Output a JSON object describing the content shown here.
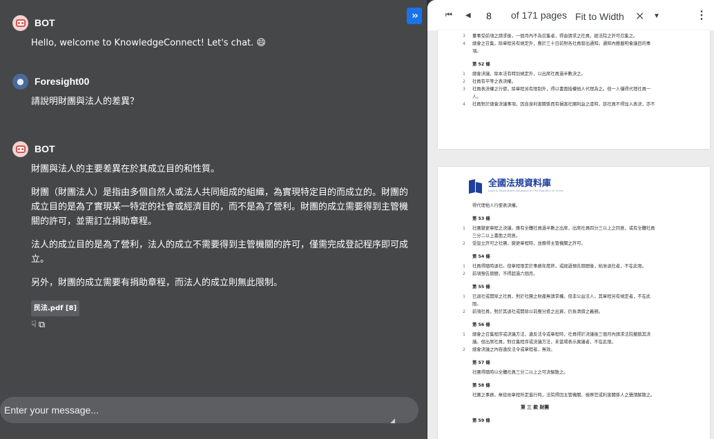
{
  "chat": {
    "expand_icon": "chevrons-right-icon",
    "messages": [
      {
        "sender": "BOT",
        "paragraphs": [
          "Hello, welcome to KnowledgeConnect! Let's chat. 😄"
        ]
      },
      {
        "sender": "Foresight00",
        "paragraphs": [
          "請說明財團與法人的差異？"
        ]
      },
      {
        "sender": "BOT",
        "paragraphs": [
          "財團與法人的主要差異在於其成立目的和性質。",
          "財團（財團法人）是指由多個自然人或法人共同組成的組織，為實現特定目的而成立的。財團的成立目的是為了實現某一特定的社會或經濟目的，而不是為了營利。財團的成立需要得到主管機關的許可，並需訂立捐助章程。",
          "法人的成立目的是為了營利，法人的成立不需要得到主管機關的許可，僅需完成登記程序即可成立。",
          "另外，財團的成立需要有捐助章程，而法人的成立則無此限制。"
        ],
        "source_chip": "民法.pdf [8]"
      }
    ],
    "input_placeholder": "Enter your message..."
  },
  "viewer": {
    "page_number": "8",
    "page_total_label": "of 171 pages",
    "zoom_label": "Fit to Width",
    "clear_symbol": "✕",
    "dropdown_symbol": "▼",
    "more_symbol": "⋮",
    "first_symbol": "⏮",
    "prev_symbol": "◀"
  },
  "pdf": {
    "page1_lines": [
      {
        "n": "3",
        "t": "董事受前項之請求後，一個月內不為召集者，得由請求之社員，經法院之許可召集之。"
      },
      {
        "n": "4",
        "t": "總會之召集，除章程另有規定外，應於三十日前對各社員發出通知。通知內應載明會議目的事"
      },
      {
        "n": "",
        "t": "項。"
      }
    ],
    "page1_art52": "第 52 條",
    "page1_art52_lines": [
      {
        "n": "1",
        "t": "總會決議，除本法有特別規定外，以出席社員過半數決之。"
      },
      {
        "n": "2",
        "t": "社員有平等之表決權。"
      },
      {
        "n": "3",
        "t": "社員表決權之行使，除章程另有限制外，得以書面授權他人代理為之。但一人僅得代理社員一"
      },
      {
        "n": "",
        "t": "人。"
      },
      {
        "n": "4",
        "t": "社員對於總會決議事項，因自身利害關係而有損害社團利益之虞時，該社員不得加入表決，亦不"
      }
    ],
    "logo_text": "全國法規資料庫",
    "logo_subtext": "Laws & Regulations Database of The Republic of China",
    "page2_first_line": "得代理他人行使表決權。",
    "page2_articles": [
      {
        "title": "第 53 條",
        "lines": [
          {
            "n": "1",
            "t": "社團變更章程之決議，應有全體社員過半數之出席，出席社員四分三以上之同意，或有全體社員"
          },
          {
            "n": "",
            "t": "三分二以上書面之同意。"
          },
          {
            "n": "2",
            "t": "受設立許可之社團，變更章程時，並應得主管機關之許可。"
          }
        ]
      },
      {
        "title": "第 54 條",
        "lines": [
          {
            "n": "1",
            "t": "社員得隨時退社。但章程限定於事務年度終，或經過預告期間後，始准退社者，不在此限。"
          },
          {
            "n": "2",
            "t": "前項預告期間，不得超過六個月。"
          }
        ]
      },
      {
        "title": "第 55 條",
        "lines": [
          {
            "n": "1",
            "t": "已退社或開除之社員，對於社團之財產無請求權。但非公益法人，其章程另有規定者，不在此"
          },
          {
            "n": "",
            "t": "限。"
          },
          {
            "n": "2",
            "t": "前項社員，對於其退社或開除以前應分擔之出資，仍負清償之義務。"
          }
        ]
      },
      {
        "title": "第 56 條",
        "lines": [
          {
            "n": "1",
            "t": "總會之召集程序或決議方法，違反法令或章程時，社員得於決議後三個月內請求法院撤銷其決"
          },
          {
            "n": "",
            "t": "議。但出席社員，對召集程序或決議方法，未當場表示異議者，不在此限。"
          },
          {
            "n": "2",
            "t": "總會決議之內容違反法令或章程者，無效。"
          }
        ]
      },
      {
        "title": "第 57 條",
        "lines": [
          {
            "n": "",
            "t": "社團得隨時以全體社員三分二以上之可決解散之。"
          }
        ]
      },
      {
        "title": "第 58 條",
        "lines": [
          {
            "n": "",
            "t": "社團之事務，無從依章程所定進行時，法院得因主管機關、檢察官或利害關係人之聲請解散之。"
          }
        ]
      }
    ],
    "section_title": "第 三 款 財團",
    "last_article": "第 59 條"
  }
}
